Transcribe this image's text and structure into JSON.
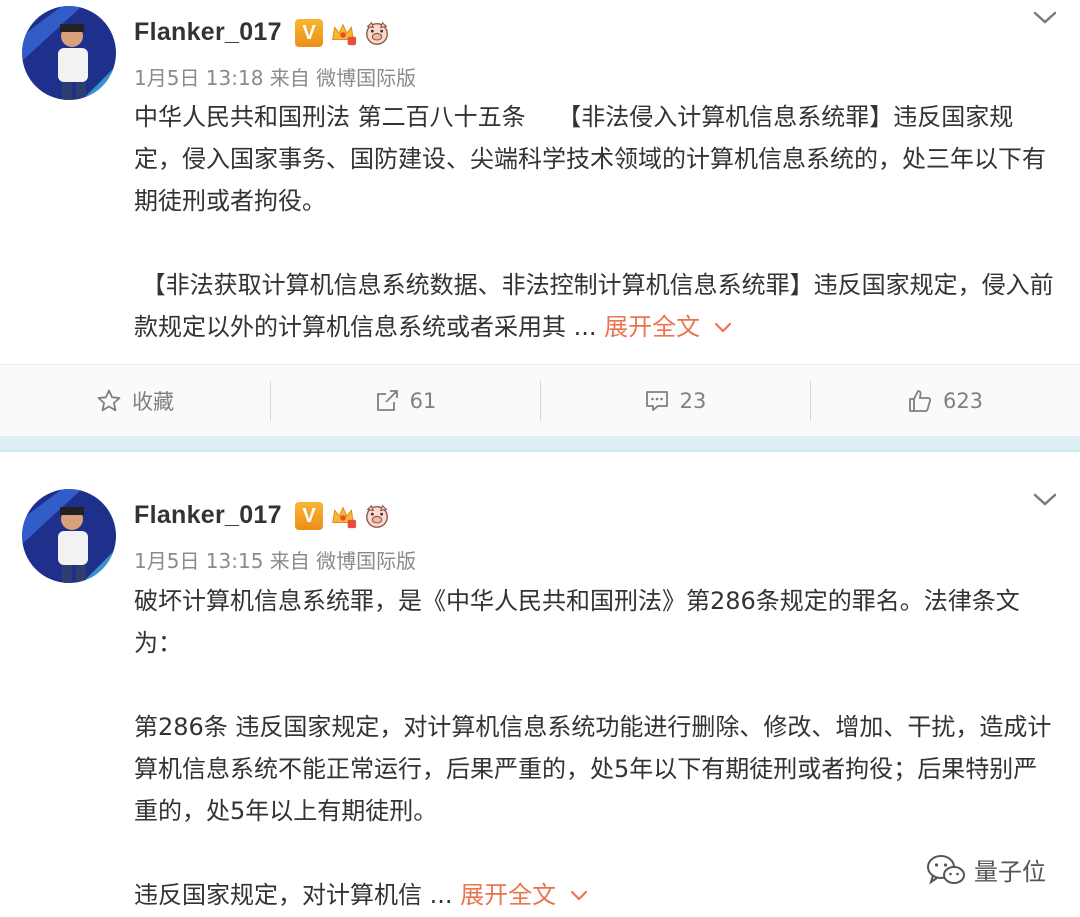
{
  "colors": {
    "accent": "#eb7350",
    "meta": "#8a8a8a",
    "divider": "#dceff2"
  },
  "posts": [
    {
      "username": "Flanker_017",
      "verified_label": "V",
      "meta": "1月5日 13:18 来自 微博国际版",
      "paragraphs": [
        "中华人民共和国刑法 第二百八十五条　 【非法侵入计算机信息系统罪】违反国家规定，侵入国家事务、国防建设、尖端科学技术领域的计算机信息系统的，处三年以下有期徒刑或者拘役。",
        " 【非法获取计算机信息系统数据、非法控制计算机信息系统罪】违反国家规定，侵入前款规定以外的计算机信息系统或者采用其 ... "
      ],
      "expand_label": "展开全文",
      "actions": {
        "favorite": "收藏",
        "repost": "61",
        "comment": "23",
        "like": "623"
      }
    },
    {
      "username": "Flanker_017",
      "verified_label": "V",
      "meta": "1月5日 13:15 来自 微博国际版",
      "paragraphs": [
        "破坏计算机信息系统罪，是《中华人民共和国刑法》第286条规定的罪名。法律条文为：",
        "第286条 违反国家规定，对计算机信息系统功能进行删除、修改、增加、干扰，造成计算机信息系统不能正常运行，后果严重的，处5年以下有期徒刑或者拘役；后果特别严重的，处5年以上有期徒刑。",
        "违反国家规定，对计算机信 ... "
      ],
      "expand_label": "展开全文"
    }
  ],
  "watermark": {
    "text": "量子位",
    "icon": "wechat-icon"
  }
}
